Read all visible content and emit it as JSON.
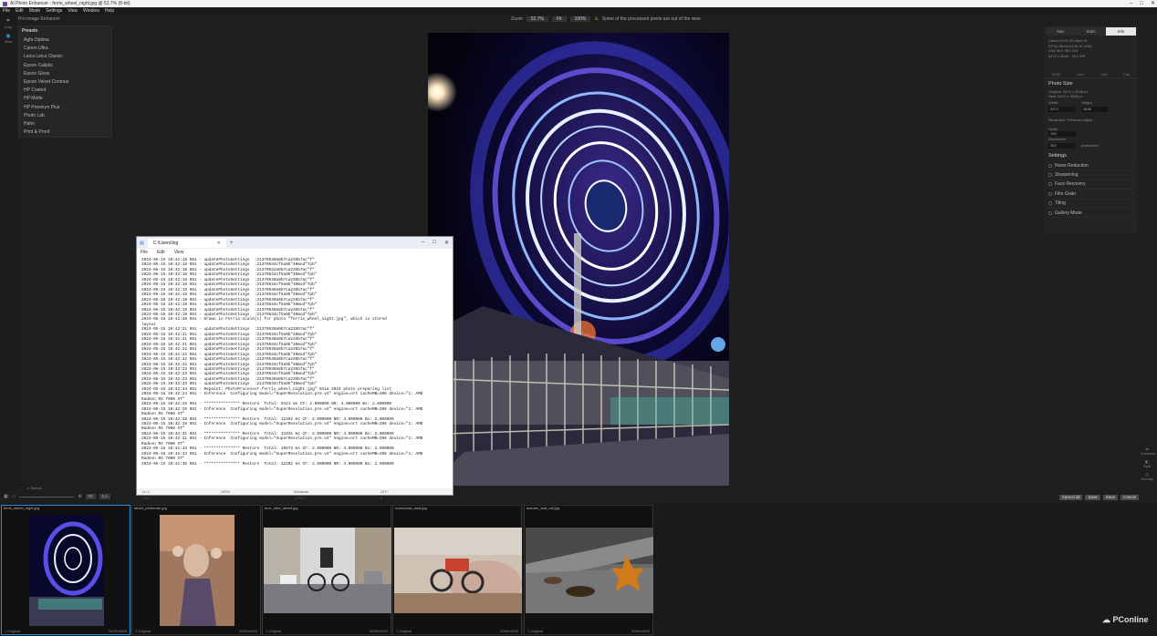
{
  "window": {
    "title": "AI Photo Enhancer - ferris_wheel_night.jpg @ 52.7% (8-bit)"
  },
  "menubar": [
    "File",
    "Edit",
    "Mode",
    "Settings",
    "View",
    "Window",
    "Help"
  ],
  "brand": "Pro Image Enhancer",
  "left_tools": [
    {
      "icon": "crop-icon",
      "label": "Crop"
    },
    {
      "icon": "view-icon",
      "label": "View"
    }
  ],
  "dropdown": {
    "heading": "Presets",
    "items": [
      "Agfa Optima",
      "Canon Ultra",
      "Leica Leica Classic",
      "Epson Caliptic",
      "Epson Gloss",
      "Epson Velvet Contrast",
      "HP Coated",
      "HP Matte",
      "HP Premium Plus",
      "Photo Lab",
      "Hahn",
      "Print & Proof"
    ]
  },
  "topcenter": {
    "zoom_label": "Zoom",
    "zoom_value": "52.7%",
    "mode_a": "Fit",
    "mode_b": "100%",
    "warning": "Some of the processed pixels are out of the view"
  },
  "rightpanel": {
    "tabs": [
      "Nav",
      "Stats",
      "Info"
    ],
    "info_lines": [
      "Canon EOS 5D Mark IV",
      "EF16-35mm f/2.8L III USM",
      "1/4s f/8.0 ISO 200",
      "5472 x 3648 · 20.0 MP"
    ],
    "icon_row": [
      "RGB",
      "Lum",
      "Hist",
      "Clip"
    ],
    "photo_size": {
      "title": "Photo Size",
      "lines": [
        "Original: 5472 x 3648 px",
        "New: 5472 x 3648 px"
      ],
      "width_label": "Width",
      "height_label": "Height",
      "width": "5472",
      "height": "3648",
      "resample": "Resample: Preserve edges",
      "scale_label": "Scale",
      "scale_value": "100",
      "resolution_label": "Resolution",
      "resolution_value": "300",
      "unit": "pixels/inch"
    },
    "settings": {
      "title": "Settings",
      "items": [
        "Noise Reduction",
        "Sharpening",
        "Face Recovery",
        "Film Grain",
        "Tiling",
        "Gallery Mode"
      ]
    }
  },
  "notepad": {
    "tab_title": "C:\\Users\\log",
    "menu": [
      "File",
      "Edit",
      "View"
    ],
    "lines": [
      "2024-05-15 10:42:18 051 - updatePhotoSettings  :21370530a9b7ca235b7ac\"f\"",
      "2024-05-15 10:42:18 051 - updatePhotoSettings  :21370534cf5a9b\"40mod\"7pb\"",
      "2024-05-15 10:42:18 051 - updatePhotoSettings  :21370532a9b7ca235b7ac\"f\"",
      "2024-05-15 10:42:18 051 - updatePhotoSettings  :21370534cf5a9b\"40mod\"7pb\"",
      "2024-05-15 10:42:18 051 - updatePhotoSettings  :21370530a9b7ca235b7ac\"f\"",
      "2024-05-15 10:42:18 051 - updatePhotoSettings  :21370534cf5a9b\"40mod\"7pb\"",
      "2024-05-15 10:42:19 051 - updatePhotoSettings  :21370530a9b7ca235b7ac\"f\"",
      "2024-05-15 10:42:19 051 - updatePhotoSettings  :21370534cf5a9b\"40mod\"7pb\"",
      "2024-05-15 10:42:19 051 - updatePhotoSettings  :21370530a9b7ca235b7ac\"f\"",
      "2024-05-15 10:42:19 051 - updatePhotoSettings  :21370534cf5a9b\"40mod\"7pb\"",
      "2024-05-15 10:42:19 051 - updatePhotoSettings  :21370530a9b7ca235b7ac\"f\"",
      "2024-05-15 10:42:19 051 - updatePhotoSettings  :21370534cf5a9b\"40mod\"7pb\"",
      "2024-05-15 10:42:20 051 - Drawn in Ferris:scale(1) for photo \"ferris_wheel_night.jpg\", which is stored",
      "layout",
      "2024-05-15 10:42:21 051 - updatePhotoSettings  :21370530a9b7ca235b7ac\"f\"",
      "2024-05-15 10:42:21 051 - updatePhotoSettings  :21370534cf5a9b\"40mod\"7pb\"",
      "2024-05-15 10:42:21 051 - updatePhotoSettings  :21370530a9b7ca235b7ac\"f\"",
      "2024-05-15 10:42:21 051 - updatePhotoSettings  :21370534cf5a9b\"40mod\"7pb\"",
      "2024-05-15 10:42:22 051 - updatePhotoSettings  :21370530a9b7ca235b7ac\"f\"",
      "2024-05-15 10:42:22 051 - updatePhotoSettings  :21370534cf5a9b\"40mod\"7pb\"",
      "2024-05-15 10:42:22 051 - updatePhotoSettings  :21370530a9b7ca235b7ac\"f\"",
      "2024-05-15 10:42:22 051 - updatePhotoSettings  :21370534cf5a9b\"40mod\"7pb\"",
      "2024-05-15 10:42:23 051 - updatePhotoSettings  :21370530a9b7ca235b7ac\"f\"",
      "2024-05-15 10:42:23 051 - updatePhotoSettings  :21370534cf5a9b\"40mod\"7pb\"",
      "2024-05-15 10:42:23 051 - updatePhotoSettings  :21370530a9b7ca235b7ac\"f\"",
      "2024-05-15 10:42:23 051 - updatePhotoSettings  :21370534cf5a9b\"40mod\"7pb\"",
      "2024-05-15 10:42:24 051 - Repaint: PhotoProcessor.ferris_wheel_night.jpg\" 0x1a 2024 photo preparing list",
      "",
      "2024-05-15 10:42:24 051 - Inference  Configuring model=\"SuperResolution.pre.v4\" engine=ort cacheMB=396 device=\"1: AMD",
      "Radeon RX 7900 XT\"",
      "2024-05-15 10:42:26 051 - *************** Restore  Total: 9421 ms CF: 2.000000 NR: 4.000000 Bx: 2.000000",
      "2024-05-15 10:42:26 051 - Inference  Configuring model=\"SuperResolution.pre.v4\" engine=ort cacheMB=396 device=\"1: AMD",
      "Radeon RX 7900 XT\"",
      "2024-05-15 10:42:28 051 - *************** Restore  Total: 12202 ms CF: 2.000000 NR: 4.000000 Bx: 2.000000",
      "2024-05-15 10:42:28 051 - Inference  Configuring model=\"SuperResolution.pre.v4\" engine=ort cacheMB=396 device=\"1: AMD",
      "Radeon RX 7900 XT\"",
      "2024-05-15 10:42:31 051 - *************** Restore  Total: 11031 ms CF: 2.000000 NR: 4.000000 Bx: 2.000000",
      "2024-05-15 10:42:31 051 - Inference  Configuring model=\"SuperResolution.pre.v4\" engine=ort cacheMB=396 device=\"1: AMD",
      "Radeon RX 7900 XT\"",
      "2024-05-15 10:42:33 051 - *************** Restore  Total: 10573 ms CF: 2.000000 NR: 4.000000 Bx: 2.000000",
      "2024-05-15 10:42:33 051 - Inference  Configuring model=\"SuperResolution.pre.v4\" engine=ort cacheMB=396 device=\"1: AMD",
      "Radeon RX 7900 XT\"",
      "2024-05-15 10:42:35 051 - *************** Restore  Total: 12202 ms CF: 2.000000 NR: 4.000000 Bx: 2.000000"
    ],
    "status": [
      "Ln 1, Col 1",
      "100%",
      "Windows (CRLF)",
      "UTF-8"
    ]
  },
  "bottombar": {
    "search_placeholder": "Search",
    "label_a": "Fit",
    "label_b": "1:1"
  },
  "actions": [
    "Cancel all",
    "Save",
    "Save",
    "Cancel"
  ],
  "right_tools": [
    "Compare",
    "Split",
    "Overlay"
  ],
  "filmstrip": [
    {
      "name": "ferris_wheel_night.jpg",
      "left_cap": "1 Original",
      "right_cap": "5472x3648",
      "active": true
    },
    {
      "name": "street_performer.jpg",
      "left_cap": "1 Original",
      "right_cap": "4000x6000",
      "active": false
    },
    {
      "name": "bmx_rider_street.jpg",
      "left_cap": "1 Original",
      "right_cap": "6000x4000",
      "active": false
    },
    {
      "name": "motocross_dust.jpg",
      "left_cap": "1 Original",
      "right_cap": "6000x4000",
      "active": false
    },
    {
      "name": "autumn_leaf_rail.jpg",
      "left_cap": "1 Original",
      "right_cap": "6000x4000",
      "active": false
    }
  ],
  "watermark": "PConline",
  "colors": {
    "accent": "#2b8fd6",
    "brand": "#6b3fa0",
    "warning": "#e0c050"
  }
}
